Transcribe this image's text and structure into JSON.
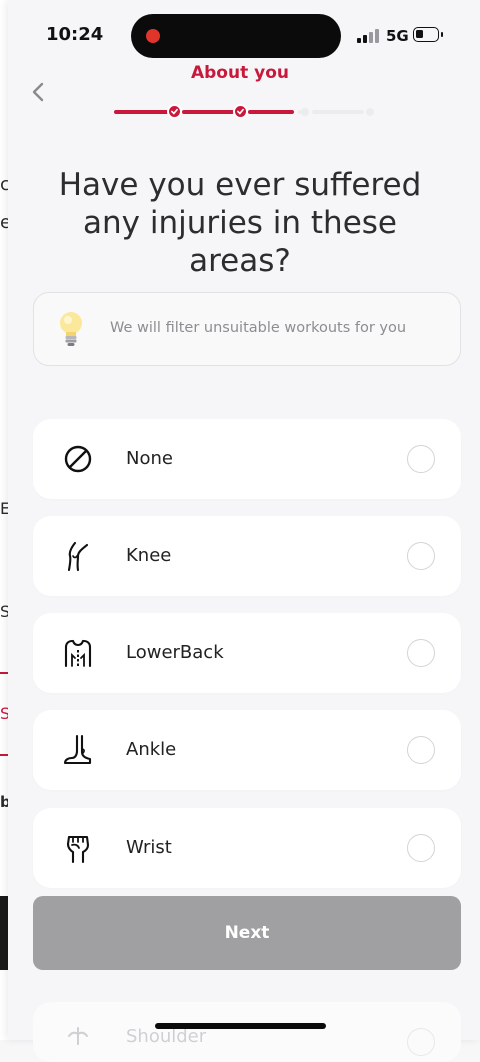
{
  "status": {
    "time": "10:24",
    "network": "5G"
  },
  "header": {
    "title": "About you",
    "progress_completed_steps": 2,
    "progress_total_steps": 5
  },
  "question": "Have you ever suffered any injuries in these areas?",
  "hint": {
    "icon": "lightbulb-icon",
    "text": "We will filter unsuitable workouts for you"
  },
  "options": [
    {
      "label": "None",
      "icon": "no-sign-icon",
      "selected": false
    },
    {
      "label": "Knee",
      "icon": "knee-icon",
      "selected": false
    },
    {
      "label": "LowerBack",
      "icon": "lower-back-icon",
      "selected": false
    },
    {
      "label": "Ankle",
      "icon": "ankle-icon",
      "selected": false
    },
    {
      "label": "Wrist",
      "icon": "wrist-icon",
      "selected": false
    },
    {
      "label": "Shoulder",
      "icon": "shoulder-icon",
      "selected": false
    }
  ],
  "next_label": "Next",
  "background_fragments": [
    "c",
    "e",
    "E",
    "S",
    "S",
    "b"
  ],
  "colors": {
    "accent": "#c8193c",
    "button_disabled": "#a0a0a2",
    "background": "#f6f6f8"
  }
}
